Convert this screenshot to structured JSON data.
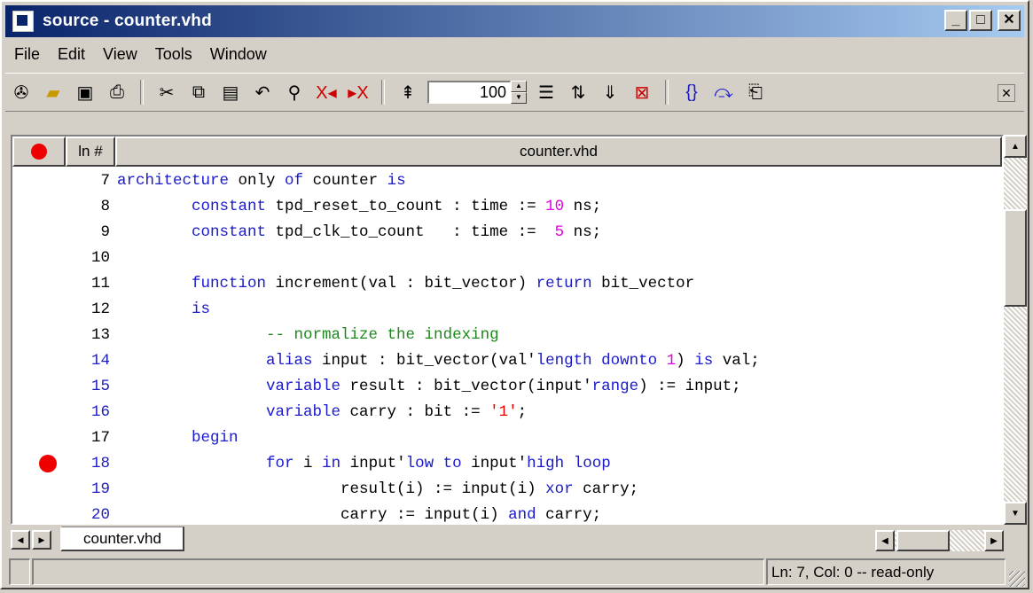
{
  "window": {
    "title": "source - counter.vhd"
  },
  "menu": [
    "File",
    "Edit",
    "View",
    "Tools",
    "Window"
  ],
  "toolbar": {
    "zoom_value": "100",
    "icons": [
      "compile-icon",
      "open-icon",
      "save-icon",
      "print-icon",
      "cut-icon",
      "copy-icon",
      "paste-icon",
      "undo-icon",
      "find-icon",
      "prev-error-icon",
      "next-error-icon",
      "insert-icon",
      "zoom-icon",
      "show-lines-icon",
      "go-to-icon",
      "toggle-bookmark-icon",
      "clear-bookmarks-icon",
      "step-icon",
      "step-over-icon",
      "step-out-icon",
      "close-icon"
    ]
  },
  "editor": {
    "column_header": {
      "ln": "ln #",
      "file": "counter.vhd"
    },
    "lines": [
      {
        "n": "7",
        "parts": [
          [
            "kw",
            "architecture"
          ],
          [
            "t",
            " only "
          ],
          [
            "kw",
            "of"
          ],
          [
            "t",
            " counter "
          ],
          [
            "kw",
            "is"
          ]
        ]
      },
      {
        "n": "8",
        "parts": [
          [
            "t",
            "        "
          ],
          [
            "kw",
            "constant"
          ],
          [
            "t",
            " tpd_reset_to_count : time := "
          ],
          [
            "num",
            "10"
          ],
          [
            "t",
            " ns;"
          ]
        ]
      },
      {
        "n": "9",
        "parts": [
          [
            "t",
            "        "
          ],
          [
            "kw",
            "constant"
          ],
          [
            "t",
            " tpd_clk_to_count   : time := "
          ],
          [
            "num",
            " 5"
          ],
          [
            "t",
            " ns;"
          ]
        ]
      },
      {
        "n": "10",
        "parts": []
      },
      {
        "n": "11",
        "parts": [
          [
            "t",
            "        "
          ],
          [
            "kw",
            "function"
          ],
          [
            "t",
            " increment(val : bit_vector) "
          ],
          [
            "kw",
            "return"
          ],
          [
            "t",
            " bit_vector"
          ]
        ]
      },
      {
        "n": "12",
        "parts": [
          [
            "t",
            "        "
          ],
          [
            "kw",
            "is"
          ]
        ]
      },
      {
        "n": "13",
        "parts": [
          [
            "t",
            "                "
          ],
          [
            "cm",
            "-- normalize the indexing"
          ]
        ]
      },
      {
        "n": "14",
        "parts": [
          [
            "t",
            "                "
          ],
          [
            "kw",
            "alias"
          ],
          [
            "t",
            " input : bit_vector(val'"
          ],
          [
            "kw",
            "length"
          ],
          [
            "t",
            " "
          ],
          [
            "kw",
            "downto"
          ],
          [
            "t",
            " "
          ],
          [
            "num",
            "1"
          ],
          [
            "t",
            ") "
          ],
          [
            "kw",
            "is"
          ],
          [
            "t",
            " val;"
          ]
        ],
        "blue": true
      },
      {
        "n": "15",
        "parts": [
          [
            "t",
            "                "
          ],
          [
            "kw",
            "variable"
          ],
          [
            "t",
            " result : bit_vector(input'"
          ],
          [
            "kw",
            "range"
          ],
          [
            "t",
            ") := input;"
          ]
        ],
        "blue": true
      },
      {
        "n": "16",
        "parts": [
          [
            "t",
            "                "
          ],
          [
            "kw",
            "variable"
          ],
          [
            "t",
            " carry : bit := "
          ],
          [
            "str",
            "'1'"
          ],
          [
            "t",
            ";"
          ]
        ],
        "blue": true
      },
      {
        "n": "17",
        "parts": [
          [
            "t",
            "        "
          ],
          [
            "kw",
            "begin"
          ]
        ]
      },
      {
        "n": "18",
        "parts": [
          [
            "t",
            "                "
          ],
          [
            "kw",
            "for"
          ],
          [
            "t",
            " i "
          ],
          [
            "kw",
            "in"
          ],
          [
            "t",
            " input'"
          ],
          [
            "kw",
            "low"
          ],
          [
            "t",
            " "
          ],
          [
            "kw",
            "to"
          ],
          [
            "t",
            " input'"
          ],
          [
            "kw",
            "high"
          ],
          [
            "t",
            " "
          ],
          [
            "kw",
            "loop"
          ]
        ],
        "blue": true,
        "breakpoint": true
      },
      {
        "n": "19",
        "parts": [
          [
            "t",
            "                        result(i) := input(i) "
          ],
          [
            "kw",
            "xor"
          ],
          [
            "t",
            " carry;"
          ]
        ],
        "blue": true
      },
      {
        "n": "20",
        "parts": [
          [
            "t",
            "                        carry := input(i) "
          ],
          [
            "kw",
            "and"
          ],
          [
            "t",
            " carry;"
          ]
        ],
        "blue": true
      }
    ]
  },
  "tabs": [
    "counter.vhd"
  ],
  "status": {
    "position": "Ln:   7, Col:  0  -- read-only"
  },
  "colors": {
    "keyword": "#1a1acc",
    "comment": "#1b8a1b",
    "number": "#e000e0",
    "string": "#ee0000",
    "breakpoint": "#ee0000",
    "title_start": "#0a246a",
    "title_end": "#a6caf0"
  }
}
